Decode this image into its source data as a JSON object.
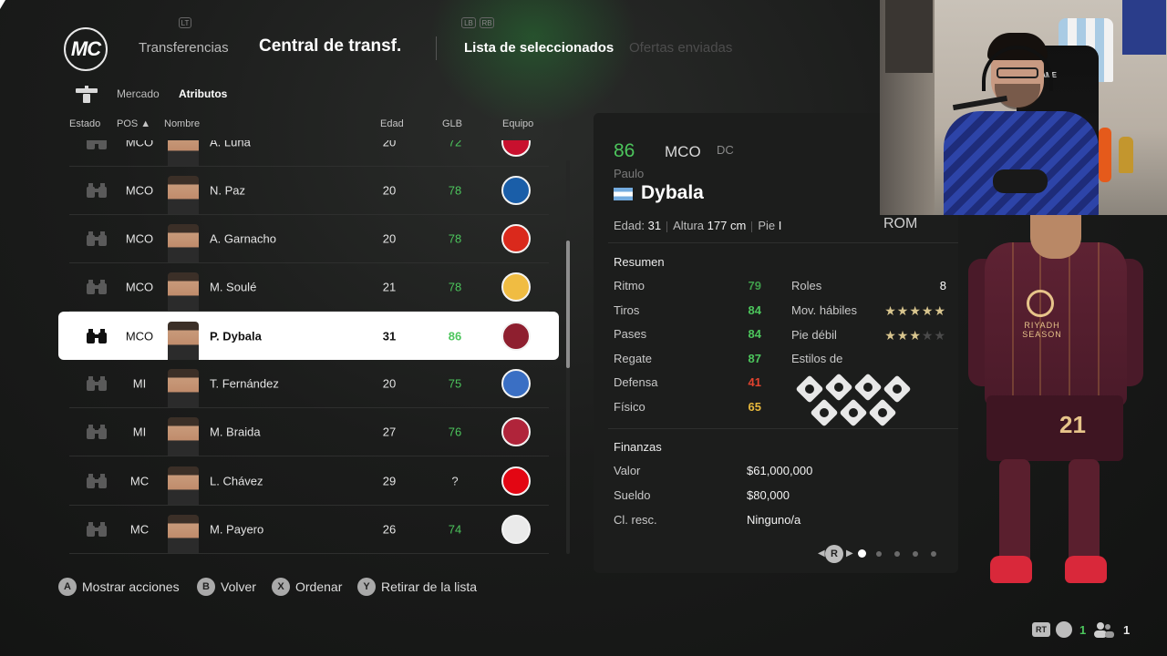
{
  "header": {
    "logo_text": "MC",
    "tabs": [
      "Transferencias",
      "Central de transf.",
      "Lista de seleccionados",
      "Ofertas enviadas"
    ],
    "hint_left": "LT",
    "hint_right_a": "LB",
    "hint_right_b": "RB"
  },
  "subtabs": [
    "Mercado",
    "Atributos"
  ],
  "table": {
    "headers": {
      "status": "Estado",
      "pos": "POS ▲",
      "name": "Nombre",
      "age": "Edad",
      "ovr": "GLB",
      "club": "Equipo"
    },
    "rows": [
      {
        "pos": "MCO",
        "name": "A. Luna",
        "age": "20",
        "ovr": "72",
        "club_color": "#c8102e"
      },
      {
        "pos": "MCO",
        "name": "N. Paz",
        "age": "20",
        "ovr": "78",
        "club_color": "#1a5ea8"
      },
      {
        "pos": "MCO",
        "name": "A. Garnacho",
        "age": "20",
        "ovr": "78",
        "club_color": "#da291c"
      },
      {
        "pos": "MCO",
        "name": "M. Soulé",
        "age": "21",
        "ovr": "78",
        "club_color": "#f0bc42"
      },
      {
        "pos": "MCO",
        "name": "P. Dybala",
        "age": "31",
        "ovr": "86",
        "club_color": "#8e1f2f",
        "selected": true
      },
      {
        "pos": "MI",
        "name": "T. Fernández",
        "age": "20",
        "ovr": "75",
        "club_color": "#3a6fc4"
      },
      {
        "pos": "MI",
        "name": "M. Braida",
        "age": "27",
        "ovr": "76",
        "club_color": "#b0243a"
      },
      {
        "pos": "MC",
        "name": "L. Chávez",
        "age": "29",
        "ovr": "?",
        "club_color": "#e30613"
      },
      {
        "pos": "MC",
        "name": "M. Payero",
        "age": "26",
        "ovr": "74",
        "club_color": "#eaeaea"
      }
    ]
  },
  "detail": {
    "ovr": "86",
    "pos": "MCO",
    "alt_pos": "DC",
    "first_name": "Paulo",
    "last_name": "Dybala",
    "age_label": "Edad:",
    "age": "31",
    "height_label": "Altura",
    "height": "177 cm",
    "foot_label": "Pie",
    "foot": "I",
    "club": "ROM",
    "summary_title": "Resumen",
    "attributes": [
      {
        "label": "Ritmo",
        "value": "79",
        "color": "dim"
      },
      {
        "label": "Tiros",
        "value": "84",
        "color": "green"
      },
      {
        "label": "Pases",
        "value": "84",
        "color": "green"
      },
      {
        "label": "Regate",
        "value": "87",
        "color": "green"
      },
      {
        "label": "Defensa",
        "value": "41",
        "color": "red"
      },
      {
        "label": "Físico",
        "value": "65",
        "color": "yellow"
      }
    ],
    "roles_label": "Roles",
    "roles_value": "8",
    "skill_moves_label": "Mov. hábiles",
    "skill_moves_stars": 5,
    "weak_foot_label": "Pie débil",
    "weak_foot_stars": 3,
    "playstyles_label": "Estilos de",
    "finance_title": "Finanzas",
    "finances": [
      {
        "label": "Valor",
        "value": "$61,000,000"
      },
      {
        "label": "Sueldo",
        "value": "$80,000"
      },
      {
        "label": "Cl. resc.",
        "value": "Ninguno/a"
      }
    ],
    "pager_button": "R",
    "pager_pages": 5,
    "pager_active": 1
  },
  "player_render": {
    "number": "21",
    "sponsor": "RIYADH SEASON"
  },
  "webcam": {
    "chair_label": "GAME"
  },
  "footer": {
    "hints": [
      {
        "button": "A",
        "label": "Mostrar acciones"
      },
      {
        "button": "B",
        "label": "Volver"
      },
      {
        "button": "X",
        "label": "Ordenar"
      },
      {
        "button": "Y",
        "label": "Retirar de la lista"
      }
    ]
  },
  "status": {
    "rt_label": "RT",
    "count_a": "1",
    "count_b": "1"
  }
}
